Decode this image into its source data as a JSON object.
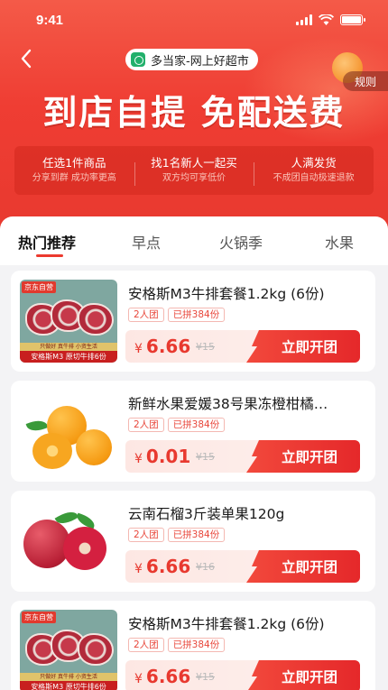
{
  "status_bar": {
    "time": "9:41"
  },
  "header": {
    "title": "多当家-网上好超市",
    "rules": "规则",
    "headline": "到店自提 免配送费"
  },
  "benefits": [
    {
      "title": "任选1件商品",
      "sub": "分享到群 成功率更高"
    },
    {
      "title": "找1名新人一起买",
      "sub": "双方均可享低价"
    },
    {
      "title": "人满发货",
      "sub": "不成团自动极速退款"
    }
  ],
  "tabs": [
    {
      "label": "热门推荐",
      "active": true
    },
    {
      "label": "早点",
      "active": false
    },
    {
      "label": "火锅季",
      "active": false
    },
    {
      "label": "水果",
      "active": false
    }
  ],
  "colors": {
    "accent": "#ec3a2f",
    "hero": "#ef3d33"
  },
  "products": [
    {
      "title": "安格斯M3牛排套餐1.2kg (6份)",
      "tags": [
        "2人团",
        "已拼384份"
      ],
      "currency": "¥",
      "price": "6.66",
      "original": "¥15",
      "button": "立即开团",
      "image": {
        "type": "steak",
        "store_tag": "京东自营",
        "sub_strip": "只做好 真牛排 小资生活",
        "brand_strip": "安格斯M3 原切牛排6份"
      }
    },
    {
      "title": "新鲜水果爱媛38号果冻橙柑橘…",
      "tags": [
        "2人团",
        "已拼384份"
      ],
      "currency": "¥",
      "price": "0.01",
      "original": "¥15",
      "button": "立即开团",
      "image": {
        "type": "orange"
      }
    },
    {
      "title": "云南石榴3斤装单果120g",
      "tags": [
        "2人团",
        "已拼384份"
      ],
      "currency": "¥",
      "price": "6.66",
      "original": "¥16",
      "button": "立即开团",
      "image": {
        "type": "pomegranate"
      }
    },
    {
      "title": "安格斯M3牛排套餐1.2kg (6份)",
      "tags": [
        "2人团",
        "已拼384份"
      ],
      "currency": "¥",
      "price": "6.66",
      "original": "¥15",
      "button": "立即开团",
      "image": {
        "type": "steak",
        "store_tag": "京东自营",
        "sub_strip": "只做好 真牛排 小资生活",
        "brand_strip": "安格斯M3 原切牛排6份"
      }
    }
  ]
}
